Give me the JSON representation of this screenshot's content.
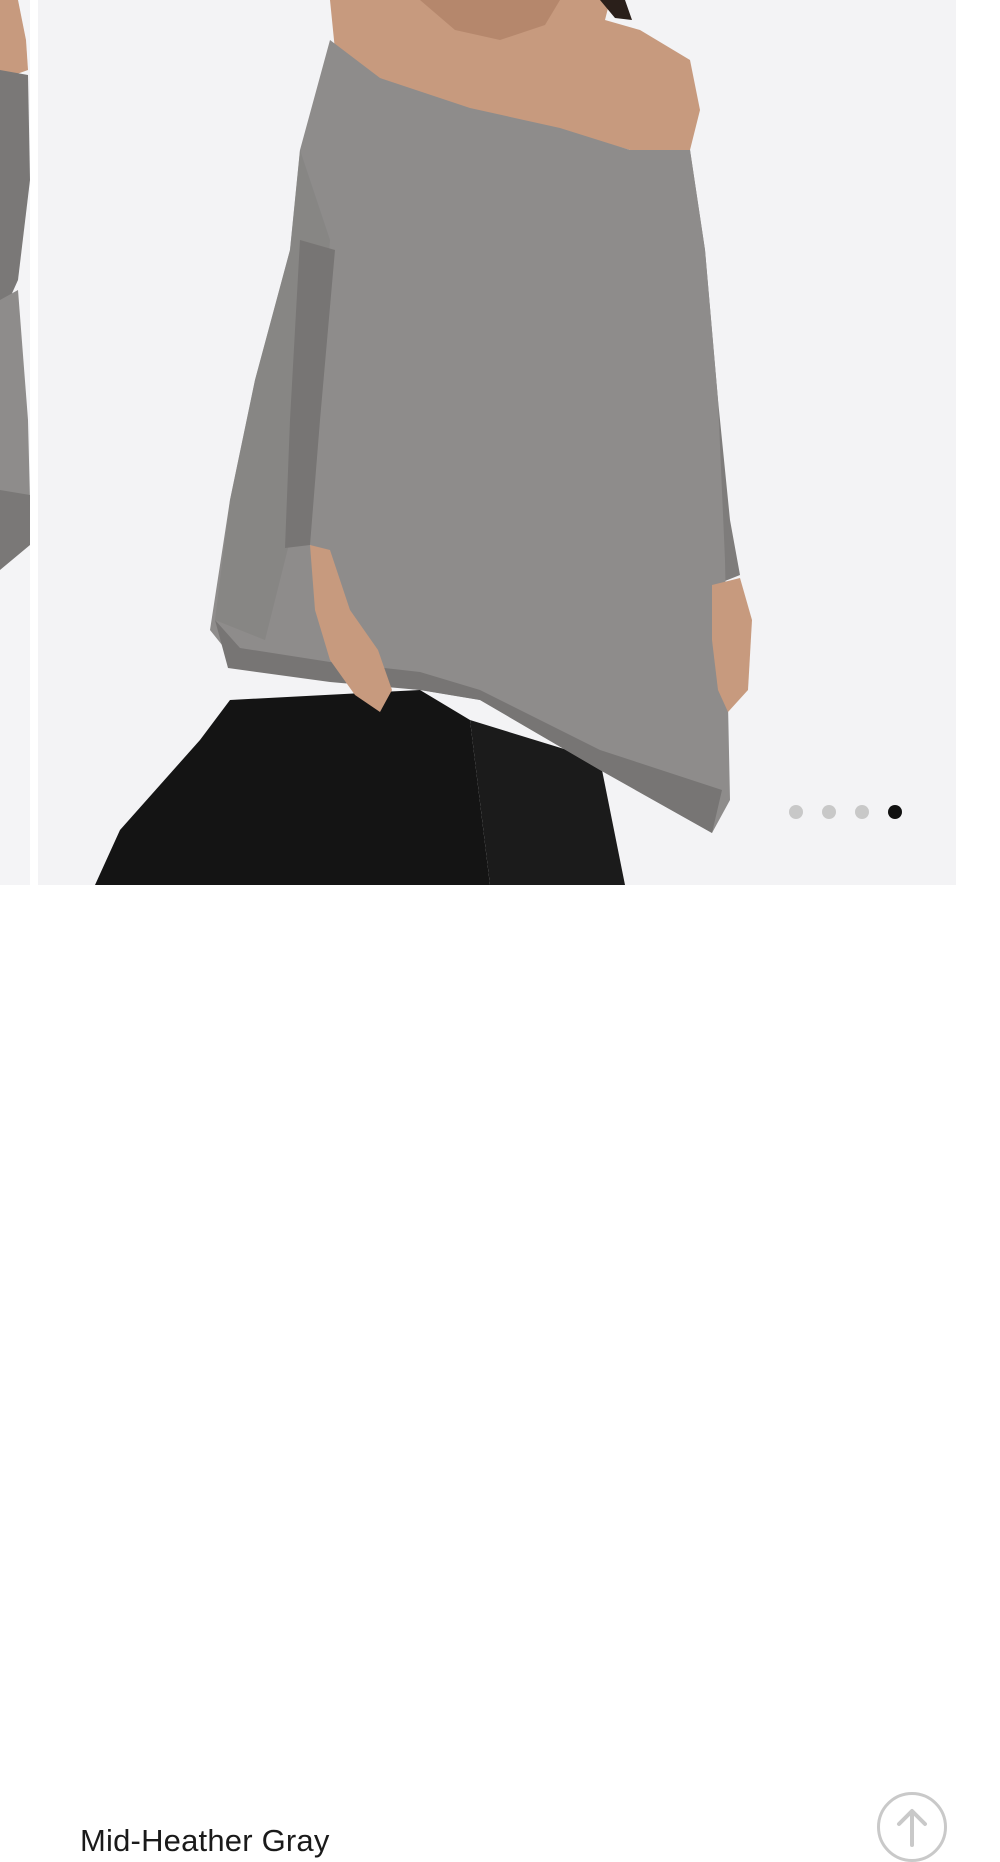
{
  "product": {
    "color_name": "Mid-Heather Gray"
  },
  "carousel": {
    "slide_count": 4,
    "active_index": 4,
    "photo": {
      "subject": "off-shoulder oversized sweatshirt",
      "sweater_color": "#8e8c8b",
      "rib_color": "#7a7877",
      "skin_color": "#c79a7e",
      "leggings_color": "#141414",
      "backdrop_color": "#f3f3f5"
    }
  },
  "icons": {
    "scroll_top": "arrow-up-circle-icon"
  }
}
